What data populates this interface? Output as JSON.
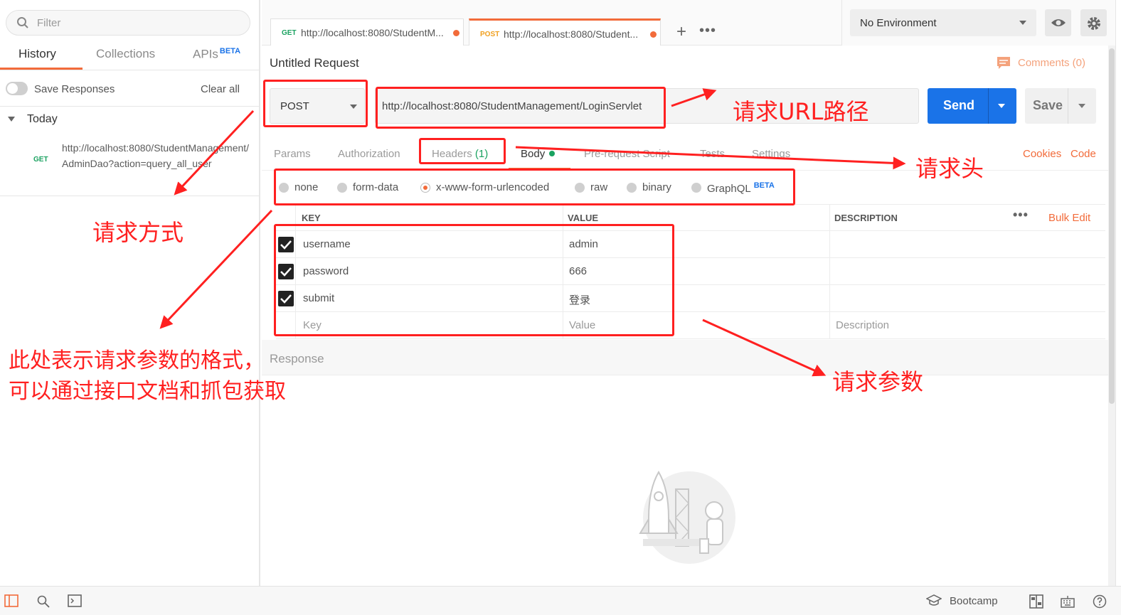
{
  "sidebar": {
    "filter_placeholder": "Filter",
    "tabs": {
      "history": "History",
      "collections": "Collections",
      "apis": "APIs",
      "apis_badge": "BETA"
    },
    "save_responses": "Save Responses",
    "clear_all": "Clear all",
    "group": "Today",
    "history_item": {
      "method": "GET",
      "url": "http://localhost:8080/StudentManagement/AdminDao?action=query_all_user"
    }
  },
  "tabs": [
    {
      "method": "GET",
      "url": "http://localhost:8080/StudentM..."
    },
    {
      "method": "POST",
      "url": "http://localhost:8080/Student..."
    }
  ],
  "environment": "No Environment",
  "request": {
    "title": "Untitled Request",
    "comments": "Comments (0)",
    "method": "POST",
    "url": "http://localhost:8080/StudentManagement/LoginServlet",
    "send": "Send",
    "save": "Save"
  },
  "param_tabs": {
    "params": "Params",
    "authorization": "Authorization",
    "headers": "Headers",
    "headers_count": "(1)",
    "body": "Body",
    "pre_request": "Pre-request Script",
    "tests": "Tests",
    "settings": "Settings",
    "cookies": "Cookies",
    "code": "Code"
  },
  "body_types": {
    "none": "none",
    "form_data": "form-data",
    "urlencoded": "x-www-form-urlencoded",
    "raw": "raw",
    "binary": "binary",
    "graphql": "GraphQL",
    "graphql_badge": "BETA",
    "selected": "x-www-form-urlencoded"
  },
  "table": {
    "headers": {
      "key": "KEY",
      "value": "VALUE",
      "description": "DESCRIPTION",
      "bulk_edit": "Bulk Edit"
    },
    "rows": [
      {
        "key": "username",
        "value": "admin",
        "checked": true
      },
      {
        "key": "password",
        "value": "666",
        "checked": true
      },
      {
        "key": "submit",
        "value": "登录",
        "checked": true
      }
    ],
    "placeholder": {
      "key": "Key",
      "value": "Value",
      "description": "Description"
    }
  },
  "response_label": "Response",
  "statusbar": {
    "bootcamp": "Bootcamp"
  },
  "annotations": {
    "url_path": "请求URL路径",
    "headers": "请求头",
    "method": "请求方式",
    "format_line1": "此处表示请求参数的格式，",
    "format_line2": "可以通过接口文档和抓包获取",
    "params": "请求参数"
  },
  "colors": {
    "accent": "#f26b3a",
    "primary": "#1a73e8",
    "annotation": "#ff2020",
    "success": "#1aa260"
  }
}
